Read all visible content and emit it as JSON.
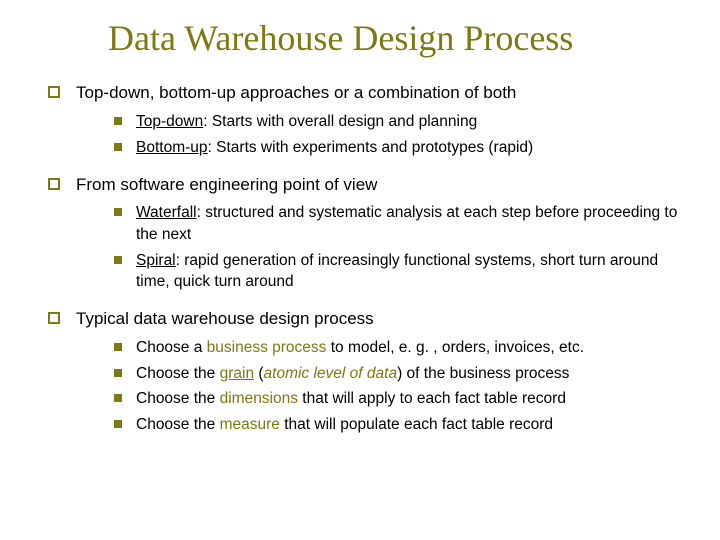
{
  "title": "Data Warehouse Design Process",
  "sections": [
    {
      "heading": "Top-down, bottom-up approaches or a combination of both",
      "items": [
        {
          "lead": "Top-down",
          "sep": ": ",
          "rest": "Starts with overall design and planning"
        },
        {
          "lead": "Bottom-up",
          "sep": ": ",
          "rest": "Starts with experiments and prototypes (rapid)"
        }
      ]
    },
    {
      "heading": "From software engineering point of view",
      "items": [
        {
          "lead": "Waterfall",
          "sep": ": ",
          "rest": "structured and systematic analysis at each step before proceeding to the next"
        },
        {
          "lead": "Spiral",
          "sep": ":  ",
          "rest": "rapid generation of increasingly functional systems, short turn around time, quick turn around"
        }
      ]
    },
    {
      "heading": "Typical data warehouse design process",
      "steps": [
        {
          "pre": "Choose a ",
          "kw": "business process",
          "post": " to model, e. g. , orders, invoices, etc."
        },
        {
          "pre": "Choose the ",
          "kw_u": "grain",
          "paren_pre": " (",
          "paren": "atomic level of data",
          "paren_post": ") ",
          "post2": "of the business process"
        },
        {
          "pre": "Choose the ",
          "kw": "dimensions",
          "post": " that will apply to each fact table record"
        },
        {
          "pre": "Choose the ",
          "kw": "measure",
          "post": " that will populate each fact table record"
        }
      ]
    }
  ]
}
